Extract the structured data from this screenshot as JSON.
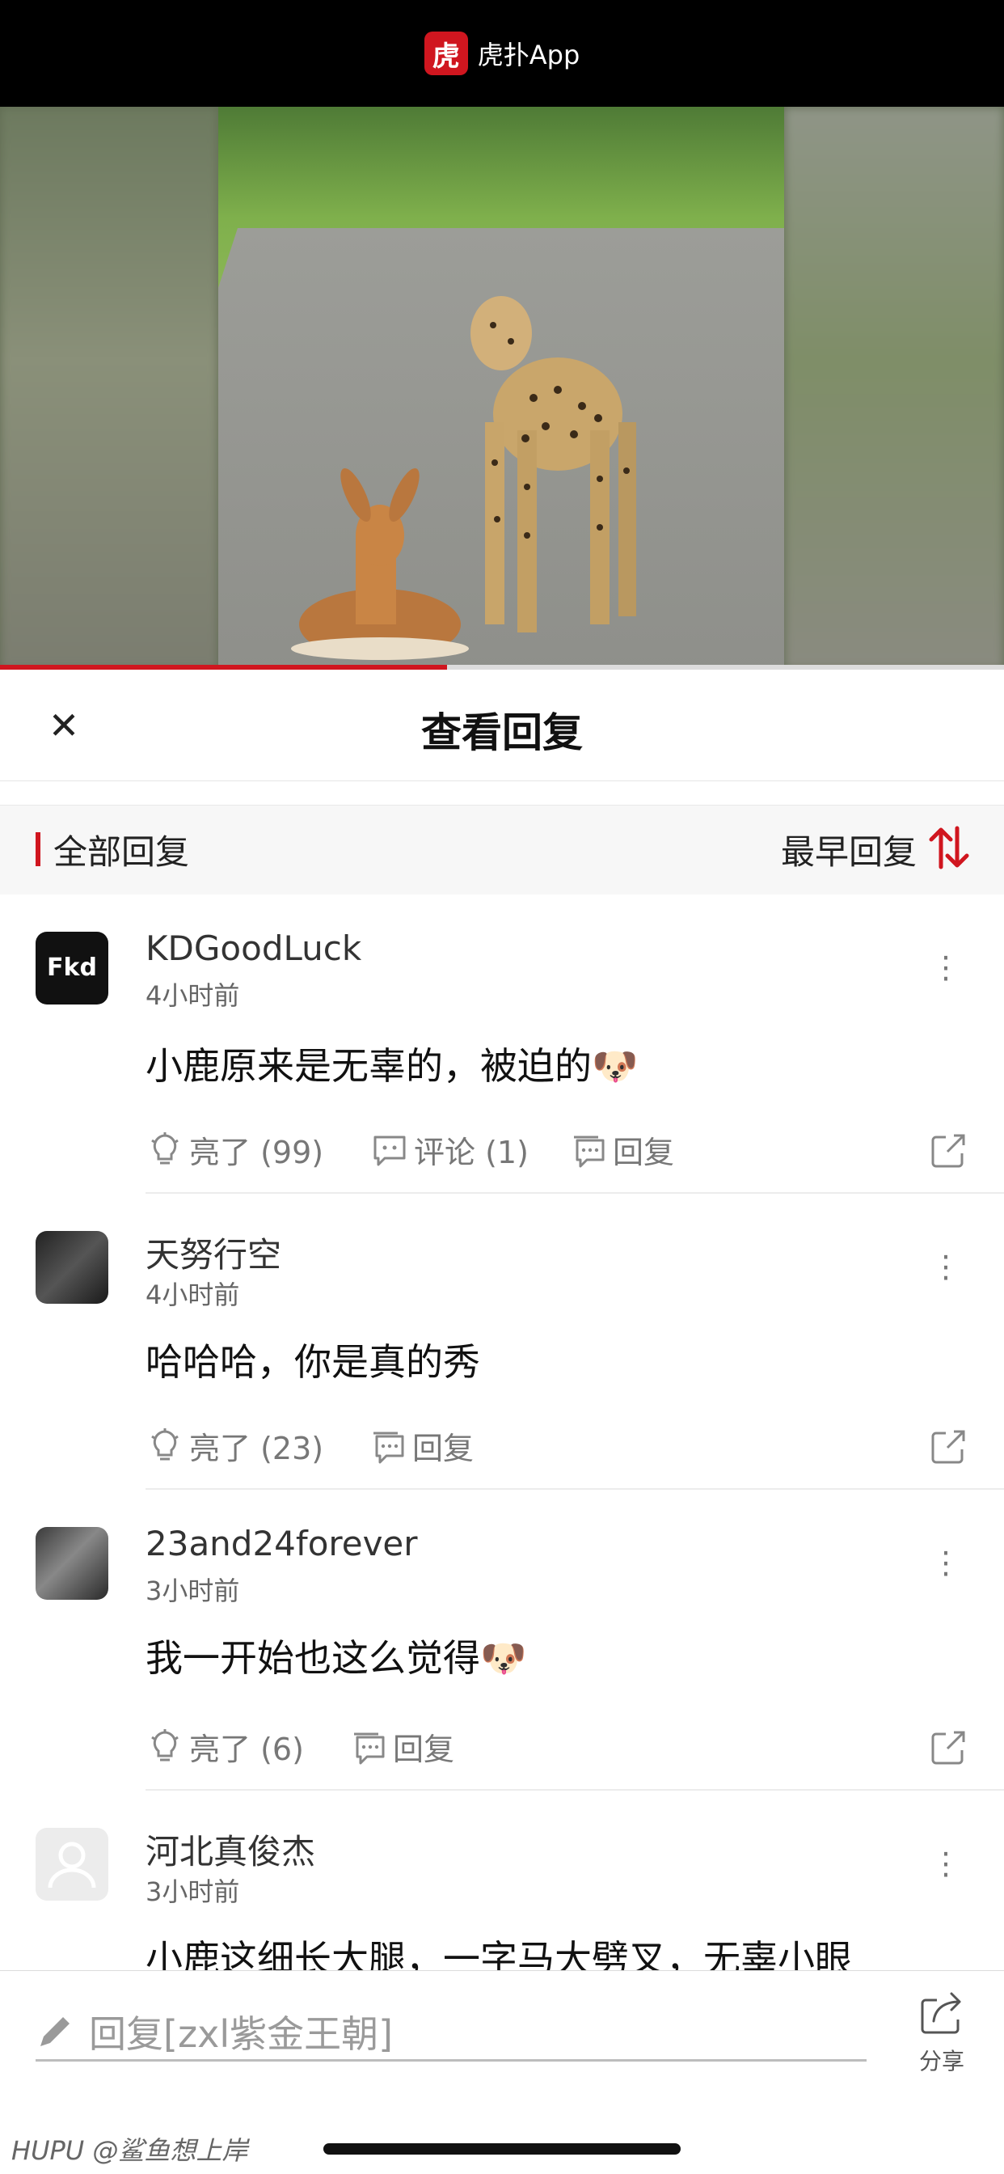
{
  "app": {
    "logo_char": "虎",
    "title": "虎扑App"
  },
  "video": {
    "progress": 0.445
  },
  "sheet": {
    "title": "查看回复",
    "close_symbol": "✕"
  },
  "filter": {
    "all_label": "全部回复",
    "sort_label": "最早回复"
  },
  "comments": [
    {
      "username": "KDGoodLuck",
      "time": "4小时前",
      "content": "小鹿原来是无辜的，被迫的🐶",
      "like_label": "亮了 (99)",
      "comment_label": "评论 (1)",
      "reply_label": "回复",
      "avatar_text": "Fkd"
    },
    {
      "username": "天努行空",
      "time": "4小时前",
      "content": "哈哈哈，你是真的秀",
      "like_label": "亮了 (23)",
      "reply_label": "回复"
    },
    {
      "username": "23and24forever",
      "time": "3小时前",
      "content": "我一开始也这么觉得🐶",
      "like_label": "亮了 (6)",
      "reply_label": "回复"
    },
    {
      "username": "河北真俊杰",
      "time": "3小时前",
      "content": "小鹿这细长大腿，一字马大劈叉，无辜小眼"
    }
  ],
  "more_symbol": "⋮",
  "bottom": {
    "reply_placeholder": "回复[zxl紫金王朝]",
    "share_label": "分享",
    "watermark": "HUPU @鲨鱼想上岸"
  },
  "colors": {
    "accent": "#d0161f",
    "muted": "#777777"
  }
}
